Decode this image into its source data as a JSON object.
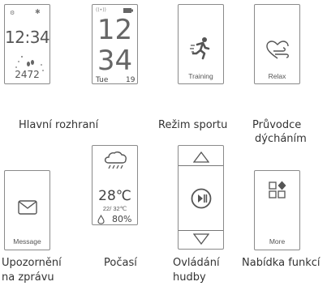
{
  "tiles": {
    "main": {
      "time": "12:34",
      "steps": "2472",
      "caption": "Hlavní rozhraní"
    },
    "clock": {
      "hour": "12",
      "minute": "34",
      "day": "Tue",
      "date": "19"
    },
    "sport": {
      "label": "Training",
      "caption": "Režim sportu"
    },
    "relax": {
      "label": "Relax",
      "caption_line1": "Průvodce",
      "caption_line2": "dýcháním"
    },
    "message": {
      "label": "Message",
      "caption_line1": "Upozornění",
      "caption_line2": "na zprávu"
    },
    "weather": {
      "temp": "28℃",
      "range": "22/ 32℃",
      "humidity": "80%",
      "caption": "Počasí"
    },
    "music": {
      "caption_line1": "Ovládání",
      "caption_line2": "hudby"
    },
    "more": {
      "label": "More",
      "caption": "Nabídka funkcí"
    }
  },
  "icons": [
    "gear-icon",
    "bluetooth-icon",
    "footprints-icon",
    "signal-icon",
    "battery-icon",
    "runner-icon",
    "heart-breath-icon",
    "envelope-icon",
    "rain-cloud-icon",
    "droplet-icon",
    "up-triangle-icon",
    "play-pause-icon",
    "down-triangle-icon",
    "apps-grid-icon"
  ]
}
